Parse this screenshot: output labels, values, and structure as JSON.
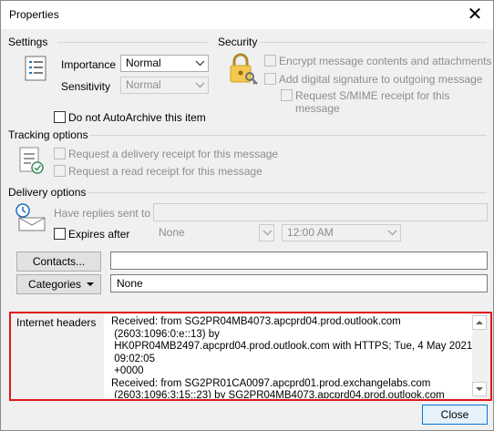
{
  "window": {
    "title": "Properties",
    "close_symbol": "✕"
  },
  "settings": {
    "heading": "Settings",
    "importance_label": "Importance",
    "importance_value": "Normal",
    "sensitivity_label": "Sensitivity",
    "sensitivity_value": "Normal",
    "autoarchive_label": "Do not AutoArchive this item"
  },
  "security": {
    "heading": "Security",
    "encrypt_label": "Encrypt message contents and attachments",
    "signature_label": "Add digital signature to outgoing message",
    "smime_label": "Request S/MIME receipt for this message"
  },
  "tracking": {
    "heading": "Tracking options",
    "delivery_receipt_label": "Request a delivery receipt for this message",
    "read_receipt_label": "Request a read receipt for this message"
  },
  "delivery": {
    "heading": "Delivery options",
    "replies_label": "Have replies sent to",
    "replies_value": "",
    "expires_label": "Expires after",
    "expires_date": "None",
    "expires_time": "12:00 AM"
  },
  "contacts": {
    "button_label": "Contacts...",
    "value": ""
  },
  "categories": {
    "button_label": "Categories",
    "value": "None"
  },
  "headers": {
    "label": "Internet headers",
    "text": "Received: from SG2PR04MB4073.apcprd04.prod.outlook.com\n (2603:1096:0:e::13) by\n HK0PR04MB2497.apcprd04.prod.outlook.com with HTTPS; Tue, 4 May 2021\n 09:02:05\n +0000\nReceived: from SG2PR01CA0097.apcprd01.prod.exchangelabs.com\n (2603:1096:3:15::23) by SG2PR04MB4073.apcprd04.prod.outlook.com"
  },
  "footer": {
    "close_label": "Close"
  },
  "colors": {
    "highlight_border": "#e2161f",
    "accent": "#0078d7"
  },
  "icons": [
    "settings-list-icon",
    "lock-key-icon",
    "tracking-checklist-icon",
    "delivery-envelope-icon",
    "chevron-down-icon"
  ]
}
